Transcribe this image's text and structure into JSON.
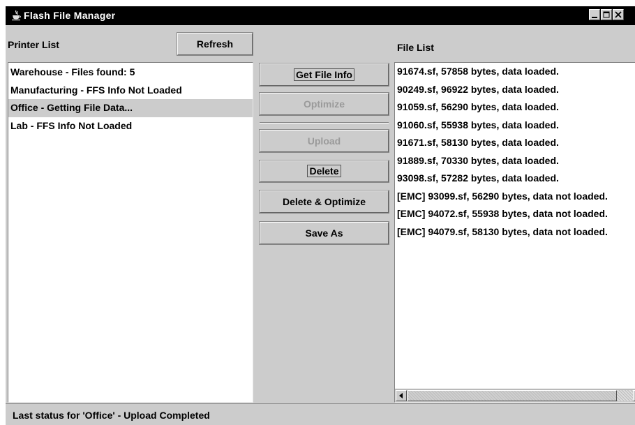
{
  "window": {
    "title": "Flash File Manager",
    "app_icon": "java-cup-icon",
    "controls": [
      "minimize-icon",
      "maximize-icon",
      "close-icon"
    ]
  },
  "printer_panel": {
    "label": "Printer List",
    "refresh_label": "Refresh",
    "items": [
      {
        "text": "Warehouse - Files found: 5",
        "selected": false
      },
      {
        "text": "Manufacturing - FFS Info Not Loaded",
        "selected": false
      },
      {
        "text": "Office - Getting File Data...",
        "selected": true
      },
      {
        "text": "Lab - FFS Info Not Loaded",
        "selected": false
      }
    ]
  },
  "actions": {
    "get_file_info": {
      "label": "Get File Info",
      "enabled": true
    },
    "optimize": {
      "label": "Optimize",
      "enabled": false
    },
    "upload": {
      "label": "Upload",
      "enabled": false
    },
    "delete": {
      "label": "Delete",
      "enabled": true
    },
    "delete_optimize": {
      "label": "Delete & Optimize",
      "enabled": true
    },
    "save_as": {
      "label": "Save As",
      "enabled": true
    }
  },
  "file_panel": {
    "label": "File List",
    "files": [
      "91674.sf, 57858 bytes, data loaded.",
      "90249.sf, 96922 bytes, data loaded.",
      "91059.sf, 56290 bytes, data loaded.",
      "91060.sf, 55938 bytes, data loaded.",
      "91671.sf, 58130 bytes, data loaded.",
      "91889.sf, 70330 bytes, data loaded.",
      "93098.sf, 57282 bytes, data loaded.",
      "[EMC] 93099.sf, 56290 bytes, data not loaded.",
      "[EMC] 94072.sf, 55938 bytes, data not loaded.",
      "[EMC] 94079.sf, 58130 bytes, data not loaded."
    ],
    "scroll_icons": [
      "scroll-left-icon",
      "scroll-right-icon"
    ]
  },
  "status": {
    "text": "Last status for 'Office' - Upload Completed"
  }
}
